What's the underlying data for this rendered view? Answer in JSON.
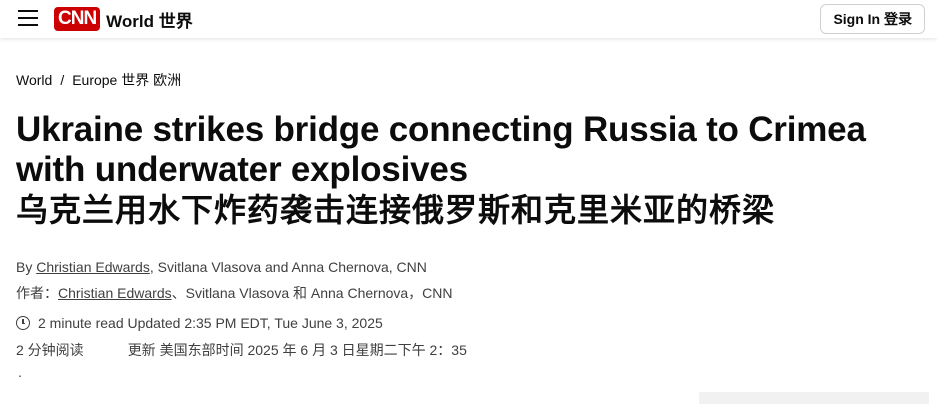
{
  "header": {
    "logo_text": "CNN",
    "logo_color": "#cc0000",
    "section_name": "World 世界",
    "signin_label": "Sign In  登录",
    "menu_icon": "hamburger-menu-icon"
  },
  "breadcrumb": {
    "items": [
      "World",
      "Europe 世界  欧洲"
    ],
    "separator": "/"
  },
  "article": {
    "headline_en": "Ukraine strikes bridge connecting Russia to Crimea with underwater explosives",
    "headline_zh": "乌克兰用水下炸药袭击连接俄罗斯和克里米亚的桥梁",
    "byline_en_prefix": "By ",
    "byline_en_author": "Christian Edwards",
    "byline_en_rest": ", Svitlana Vlasova and Anna Chernova, CNN",
    "byline_zh_prefix": "作者：",
    "byline_zh_author": "Christian Edwards",
    "byline_zh_rest": "、Svitlana Vlasova 和 Anna Chernova，CNN",
    "read_time_en": "2 minute read Updated 2:35 PM EDT, Tue June 3, 2025",
    "read_time_zh": "2 分钟阅读",
    "updated_zh": "更新 美国东部时间 2025 年 6 月 3 日星期二下午 2：35",
    "trailing_dot": "."
  }
}
